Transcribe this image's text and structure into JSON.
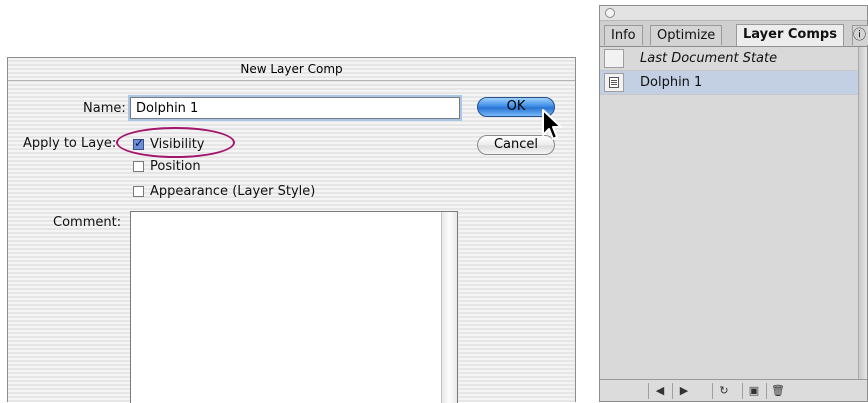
{
  "dialog": {
    "title": "New Layer Comp",
    "name_label": "Name:",
    "name_value": "Dolphin 1",
    "apply_label": "Apply to Laye",
    "apply_colon": ":",
    "checkboxes": [
      {
        "label": "Visibility",
        "checked": true
      },
      {
        "label": "Position",
        "checked": false
      },
      {
        "label": "Appearance (Layer Style)",
        "checked": false
      }
    ],
    "comment_label": "Comment:",
    "ok_label": "OK",
    "cancel_label": "Cancel",
    "highlight_color": "#a3146b",
    "ok_color": "#3e8ee6"
  },
  "panel": {
    "tabs": [
      "Info",
      "Optimize",
      "Layer Comps"
    ],
    "active_tab": "Layer Comps",
    "rows": [
      {
        "label": "Last Document State",
        "italic": true,
        "selected": false
      },
      {
        "label": "Dolphin 1",
        "italic": false,
        "selected": true,
        "icon": "layer-comp-doc-icon"
      }
    ],
    "bottom_icons": [
      "previous-arrow-icon",
      "next-arrow-icon",
      "update-icon",
      "new-comp-icon",
      "trash-icon"
    ],
    "selection_color": "#c3d0e4"
  }
}
